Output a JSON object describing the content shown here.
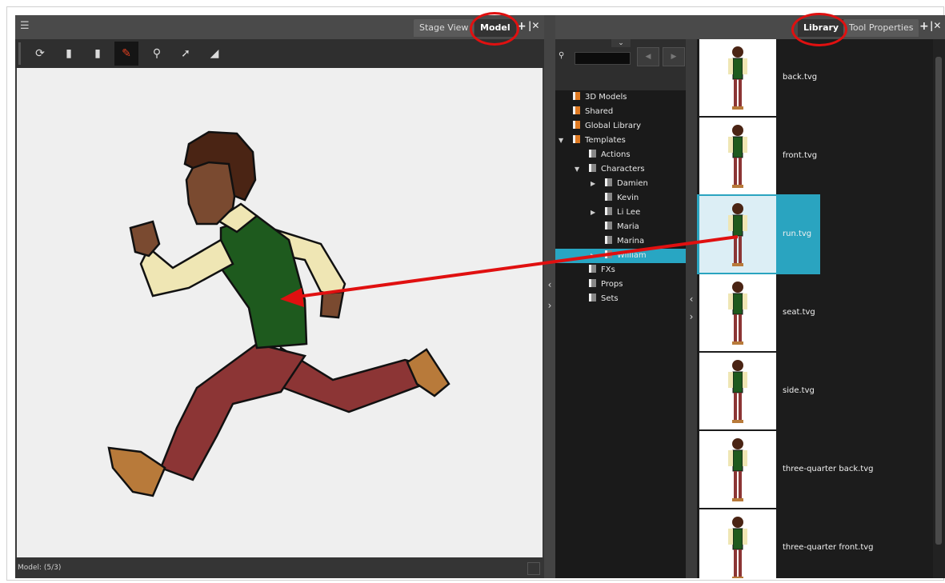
{
  "left_panel": {
    "tabs": {
      "stage_view": "Stage View",
      "model": "Model"
    },
    "status": "Model: (5/3)"
  },
  "right_panel": {
    "tabs": {
      "library": "Library",
      "tool_properties": "Tool Properties"
    },
    "tree": [
      {
        "label": "3D Models",
        "level": 0
      },
      {
        "label": "Shared",
        "level": 0
      },
      {
        "label": "Global Library",
        "level": 0
      },
      {
        "label": "Templates",
        "level": 0
      },
      {
        "label": "Actions",
        "level": 1
      },
      {
        "label": "Characters",
        "level": 1
      },
      {
        "label": "Damien",
        "level": 2
      },
      {
        "label": "Kevin",
        "level": 2
      },
      {
        "label": "Li Lee",
        "level": 2
      },
      {
        "label": "Maria",
        "level": 2
      },
      {
        "label": "Marina",
        "level": 2
      },
      {
        "label": "William",
        "level": 2,
        "selected": true
      },
      {
        "label": "FXs",
        "level": 1
      },
      {
        "label": "Props",
        "level": 1
      },
      {
        "label": "Sets",
        "level": 1
      }
    ],
    "templates": [
      {
        "label": "back.tvg"
      },
      {
        "label": "front.tvg"
      },
      {
        "label": "run.tvg",
        "selected": true
      },
      {
        "label": "seat.tvg"
      },
      {
        "label": "side.tvg"
      },
      {
        "label": "three-quarter back.tvg"
      },
      {
        "label": "three-quarter front.tvg"
      }
    ]
  },
  "colors": {
    "selection": "#28a6c3",
    "annotation": "#e01010",
    "vest": "#1e5a1e",
    "pants": "#8c3535",
    "shirt": "#efe6b4",
    "skin": "#7a4a30"
  }
}
